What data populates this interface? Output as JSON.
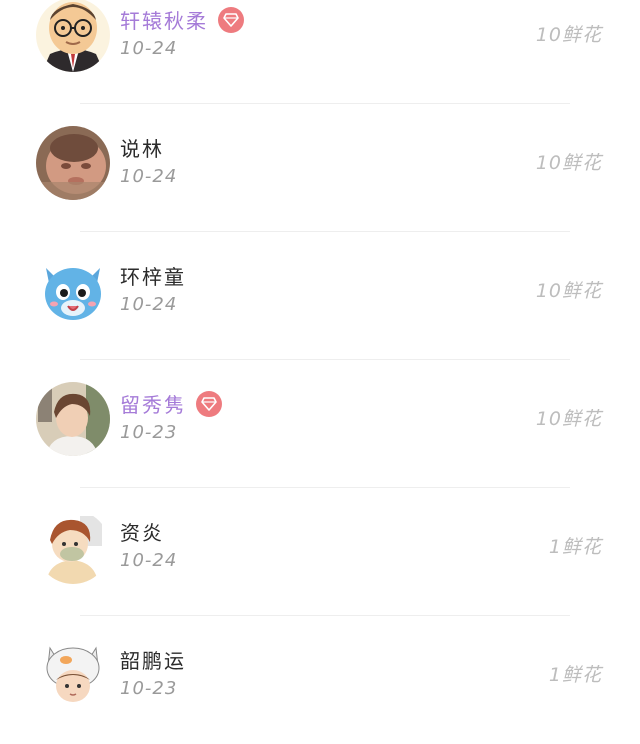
{
  "gift_list": [
    {
      "name": "轩辕秋柔",
      "vip": true,
      "date": "10-24",
      "flowers": "10鲜花",
      "avatar": "cartoon-man-glasses-avatar"
    },
    {
      "name": "说林",
      "vip": false,
      "date": "10-24",
      "flowers": "10鲜花",
      "avatar": "baby-photo-avatar"
    },
    {
      "name": "环梓童",
      "vip": false,
      "date": "10-24",
      "flowers": "10鲜花",
      "avatar": "blue-cat-avatar"
    },
    {
      "name": "留秀隽",
      "vip": true,
      "date": "10-23",
      "flowers": "10鲜花",
      "avatar": "young-man-photo-avatar"
    },
    {
      "name": "资炎",
      "vip": false,
      "date": "10-24",
      "flowers": "1鲜花",
      "avatar": "anime-boy-avatar"
    },
    {
      "name": "韶鹏运",
      "vip": false,
      "date": "10-23",
      "flowers": "1鲜花",
      "avatar": "cat-hood-child-avatar"
    }
  ],
  "colors": {
    "vip_name": "#a57bd8",
    "vip_badge": "#ee7b7f",
    "secondary_text": "#9a9a9a",
    "flowers_text": "#bdbdbd"
  }
}
